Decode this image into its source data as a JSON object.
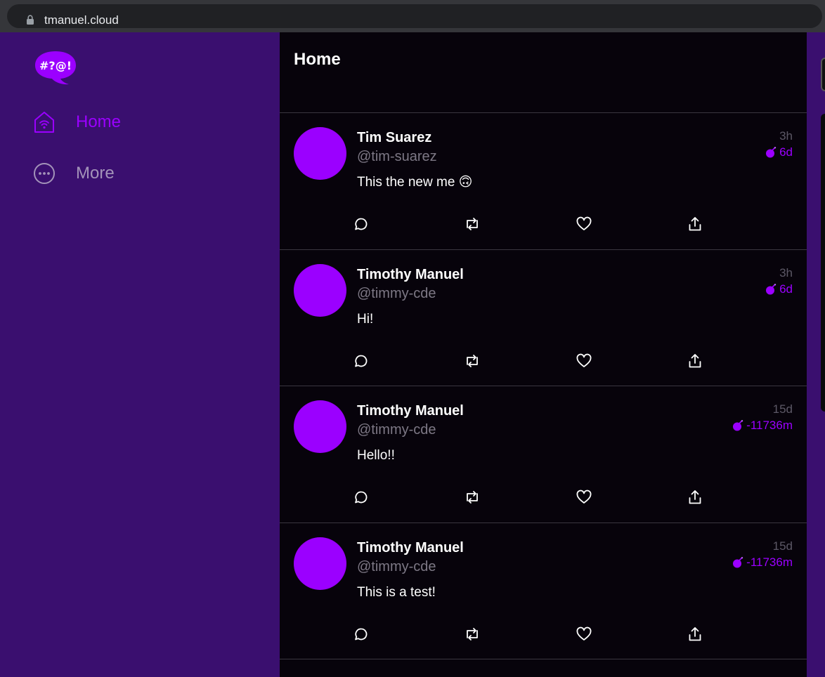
{
  "browser": {
    "url": "tmanuel.cloud"
  },
  "sidebar": {
    "logo_text": "#?@!",
    "items": [
      {
        "label": "Home",
        "icon": "home-icon",
        "active": true
      },
      {
        "label": "More",
        "icon": "more-icon",
        "active": false
      }
    ]
  },
  "feed": {
    "title": "Home",
    "posts": [
      {
        "name": "Tim Suarez",
        "handle": "@tim-suarez",
        "text": "This the new me 🙃",
        "time": "3h",
        "expiry": "6d"
      },
      {
        "name": "Timothy Manuel",
        "handle": "@timmy-cde",
        "text": "Hi!",
        "time": "3h",
        "expiry": "6d"
      },
      {
        "name": "Timothy Manuel",
        "handle": "@timmy-cde",
        "text": "Hello!!",
        "time": "15d",
        "expiry": "-11736m"
      },
      {
        "name": "Timothy Manuel",
        "handle": "@timmy-cde",
        "text": "This is a test!",
        "time": "15d",
        "expiry": "-11736m"
      }
    ]
  },
  "colors": {
    "accent": "#9b00ff",
    "sidebar_bg": "#3a0f6f",
    "feed_bg": "#07030b"
  }
}
